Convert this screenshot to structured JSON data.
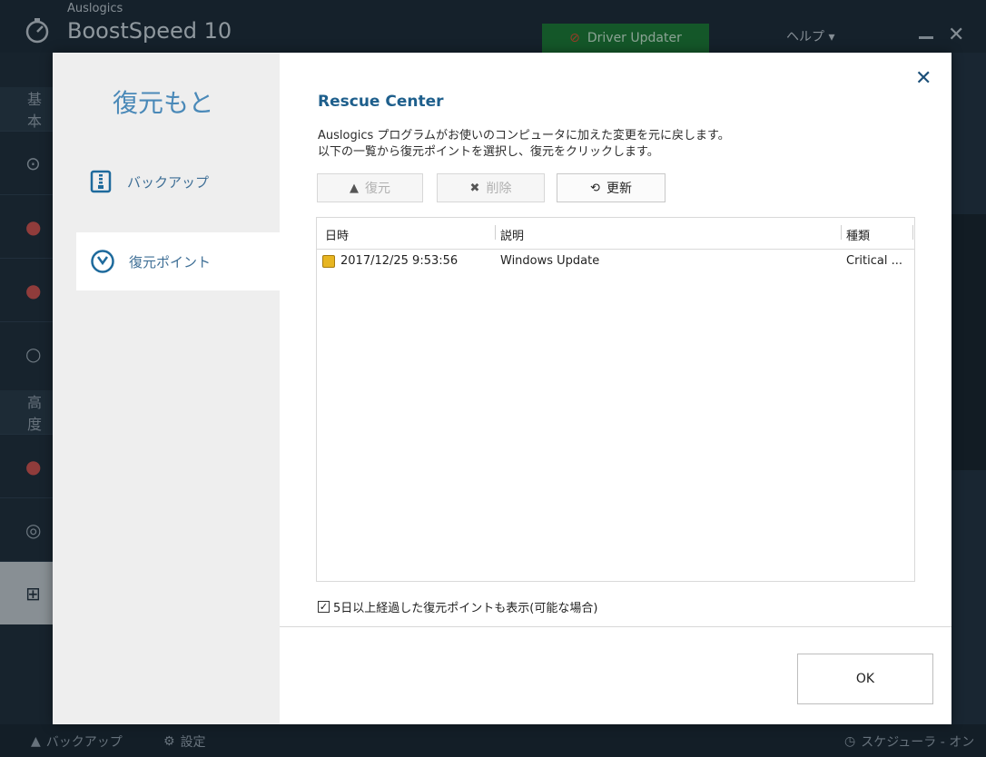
{
  "app": {
    "brand_small": "Auslogics",
    "brand_big": "BoostSpeed 10",
    "driver_updater": "Driver Updater",
    "help": "ヘルプ ▾",
    "side_sections": [
      "基本",
      "高度"
    ],
    "bottom": {
      "backup": "バックアップ",
      "settings": "設定",
      "scheduler": "スケジューラ - オン"
    }
  },
  "dialog": {
    "left_title": "復元もと",
    "nav": [
      {
        "label": "バックアップ",
        "icon": "zip-archive-icon"
      },
      {
        "label": "復元ポイント",
        "icon": "restore-point-clock-icon"
      }
    ],
    "title": "Rescue Center",
    "desc_line1": "Auslogics プログラムがお使いのコンピュータに加えた変更を元に戻します。",
    "desc_line2": "以下の一覧から復元ポイントを選択し、復元をクリックします。",
    "toolbar": {
      "restore": "復元",
      "delete": "削除",
      "refresh": "更新"
    },
    "table": {
      "columns": [
        "日時",
        "説明",
        "種類"
      ],
      "rows": [
        {
          "date": "2017/12/25 9:53:56",
          "description": "Windows Update",
          "type": "Critical ..."
        }
      ]
    },
    "show_old_checkbox": {
      "checked": true,
      "label": "5日以上経過した復元ポイントも表示(可能な場合)"
    },
    "ok": "OK",
    "colors": {
      "accent": "#1e5f8c",
      "nav_text": "#3f6f96",
      "row_icon": "#e7b521"
    }
  }
}
